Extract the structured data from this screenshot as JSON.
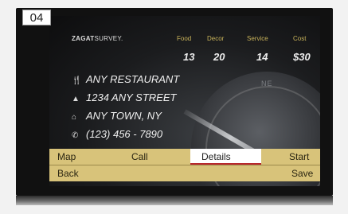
{
  "badge": "04",
  "zagat": {
    "logo_bold": "ZAGAT",
    "logo_rest": "SURVEY."
  },
  "ratings": {
    "headers": [
      "Food",
      "Decor",
      "Service",
      "Cost"
    ],
    "values": [
      "13",
      "20",
      "14",
      "$30"
    ]
  },
  "place": {
    "name": "ANY RESTAURANT",
    "street": "1234 ANY STREET",
    "city": "ANY TOWN, NY",
    "phone": "(123) 456 - 7890"
  },
  "compass": {
    "label": "NE"
  },
  "softkeys": {
    "top": {
      "map": "Map",
      "call": "Call",
      "details": "Details",
      "start": "Start"
    },
    "bottom": {
      "back": "Back",
      "save": "Save"
    }
  }
}
